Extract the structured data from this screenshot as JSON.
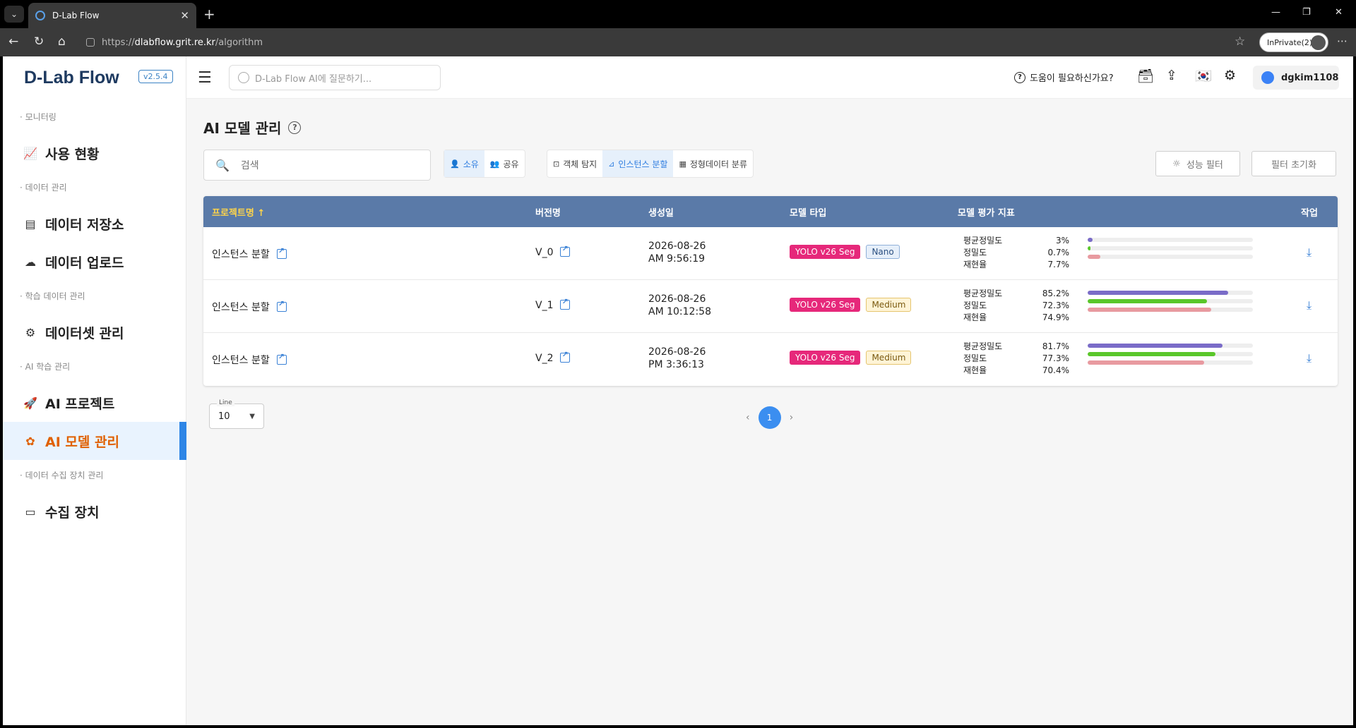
{
  "browser": {
    "tab_title": "D-Lab Flow",
    "url_prefix": "https://",
    "url_host": "dlabflow.grit.re.kr",
    "url_path": "/algorithm",
    "profile": "InPrivate(2)"
  },
  "sidebar": {
    "logo": "D-Lab Flow",
    "version": "v2.5.4",
    "sections": [
      {
        "label": "· 모니터링",
        "items": [
          {
            "label": "사용 현황",
            "icon": "monitor-chart-icon"
          }
        ]
      },
      {
        "label": "· 데이터 관리",
        "items": [
          {
            "label": "데이터 저장소",
            "icon": "storage-icon"
          },
          {
            "label": "데이터 업로드",
            "icon": "cloud-upload-icon"
          }
        ]
      },
      {
        "label": "· 학습 데이터 관리",
        "items": [
          {
            "label": "데이터셋 관리",
            "icon": "dataset-icon"
          }
        ]
      },
      {
        "label": "· AI 학습 관리",
        "items": [
          {
            "label": "AI 프로젝트",
            "icon": "rocket-icon"
          },
          {
            "label": "AI 모델 관리",
            "icon": "brain-icon",
            "active": true
          }
        ]
      },
      {
        "label": "· 데이터 수집 장치 관리",
        "items": [
          {
            "label": "수집 장치",
            "icon": "device-icon"
          }
        ]
      }
    ]
  },
  "topbar": {
    "ai_placeholder": "D-Lab Flow AI에 질문하기...",
    "help": "도움이 필요하신가요?",
    "username": "dgkim1108"
  },
  "page": {
    "title": "AI 모델 관리",
    "search_placeholder": "검색",
    "ownership": {
      "owned": "소유",
      "shared": "공유"
    },
    "task_filters": {
      "detect": "객체 탐지",
      "instance": "인스턴스 분할",
      "tabular": "정형데이터 분류"
    },
    "perf_filter": "성능 필터",
    "reset_filter": "필터 초기화"
  },
  "table": {
    "headers": {
      "project": "프로젝트명 ↑",
      "version": "버전명",
      "created": "생성일",
      "model_type": "모델 타입",
      "metrics": "모델 평가 지표",
      "action": "작업"
    },
    "metric_names": [
      "평균정밀도",
      "정밀도",
      "재현율"
    ],
    "rows": [
      {
        "project": "인스턴스 분할",
        "version": "V_0",
        "date": "2026-08-26",
        "time": "AM 9:56:19",
        "model": "YOLO v26 Seg",
        "size": "Nano",
        "size_class": "nano",
        "map": "3%",
        "precision": "0.7%",
        "recall": "7.7%",
        "map_v": 3,
        "prec_v": 0.7,
        "rec_v": 7.7
      },
      {
        "project": "인스턴스 분할",
        "version": "V_1",
        "date": "2026-08-26",
        "time": "AM 10:12:58",
        "model": "YOLO v26 Seg",
        "size": "Medium",
        "size_class": "medium",
        "map": "85.2%",
        "precision": "72.3%",
        "recall": "74.9%",
        "map_v": 85.2,
        "prec_v": 72.3,
        "rec_v": 74.9
      },
      {
        "project": "인스턴스 분할",
        "version": "V_2",
        "date": "2026-08-26",
        "time": "PM 3:36:13",
        "model": "YOLO v26 Seg",
        "size": "Medium",
        "size_class": "medium",
        "map": "81.7%",
        "precision": "77.3%",
        "recall": "70.4%",
        "map_v": 81.7,
        "prec_v": 77.3,
        "rec_v": 70.4
      }
    ]
  },
  "pagination": {
    "line_label": "Line",
    "line_value": "10",
    "current_page": "1"
  }
}
